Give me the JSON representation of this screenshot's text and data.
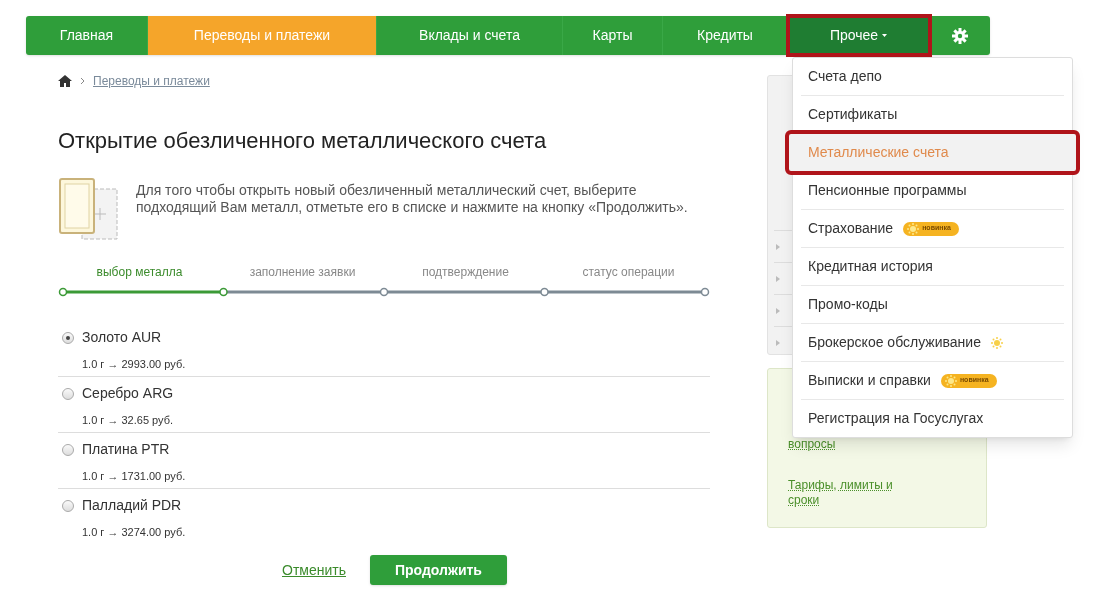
{
  "nav": [
    {
      "label": "Главная",
      "selected": false,
      "outlined": false
    },
    {
      "label": "Переводы и платежи",
      "selected": true,
      "outlined": false
    },
    {
      "label": "Вклады и счета",
      "selected": false,
      "outlined": false
    },
    {
      "label": "Карты",
      "selected": false,
      "outlined": false
    },
    {
      "label": "Кредиты",
      "selected": false,
      "outlined": false
    },
    {
      "label": "Прочее",
      "selected": false,
      "outlined": true,
      "expanded": true
    }
  ],
  "breadcrumb": [
    "Переводы и платежи"
  ],
  "title": "Открытие обезличенного металлического счета",
  "intro": "Для того чтобы открыть новый обезличенный металлический счет, выберите подходящий Вам металл, отметьте его в списке и нажмите на кнопку «Продолжить».",
  "steps": [
    {
      "label": "выбор металла",
      "selected": true
    },
    {
      "label": "заполнение заявки",
      "selected": false
    },
    {
      "label": "подтверждение",
      "selected": false
    },
    {
      "label": "статус операции",
      "selected": false
    }
  ],
  "metals": [
    {
      "name": "Золото AUR",
      "rate": "1.0 г → 2993.00 руб.",
      "selected": true
    },
    {
      "name": "Серебро ARG",
      "rate": "1.0 г → 32.65 руб.",
      "selected": false
    },
    {
      "name": "Платина PTR",
      "rate": "1.0 г → 1731.00 руб.",
      "selected": false
    },
    {
      "name": "Палладий PDR",
      "rate": "1.0 г → 3274.00 руб.",
      "selected": false
    }
  ],
  "actions": {
    "cancel": "Отменить",
    "submit": "Продолжить"
  },
  "sidebar": {
    "help_links": [
      "вопросы",
      "Тарифы, лимиты и сроки"
    ]
  },
  "menu": [
    {
      "label": "Счета депо",
      "selected": false,
      "outlined": false
    },
    {
      "label": "Сертификаты",
      "selected": false,
      "outlined": false
    },
    {
      "label": "Металлические счета",
      "selected": true,
      "outlined": true
    },
    {
      "label": "Пенсионные программы",
      "selected": false,
      "outlined": false
    },
    {
      "label": "Страхование",
      "selected": false,
      "outlined": false,
      "marker": {
        "kind": "badge",
        "text": "новинка"
      }
    },
    {
      "label": "Кредитная история",
      "selected": false,
      "outlined": false
    },
    {
      "label": "Промо-коды",
      "selected": false,
      "outlined": false
    },
    {
      "label": "Брокерское обслуживание",
      "selected": false,
      "outlined": false,
      "marker": {
        "kind": "sun"
      }
    },
    {
      "label": "Выписки и справки",
      "selected": false,
      "outlined": false,
      "marker": {
        "kind": "badge",
        "text": "новинка"
      }
    },
    {
      "label": "Регистрация на Госуслугах",
      "selected": false,
      "outlined": false
    }
  ]
}
